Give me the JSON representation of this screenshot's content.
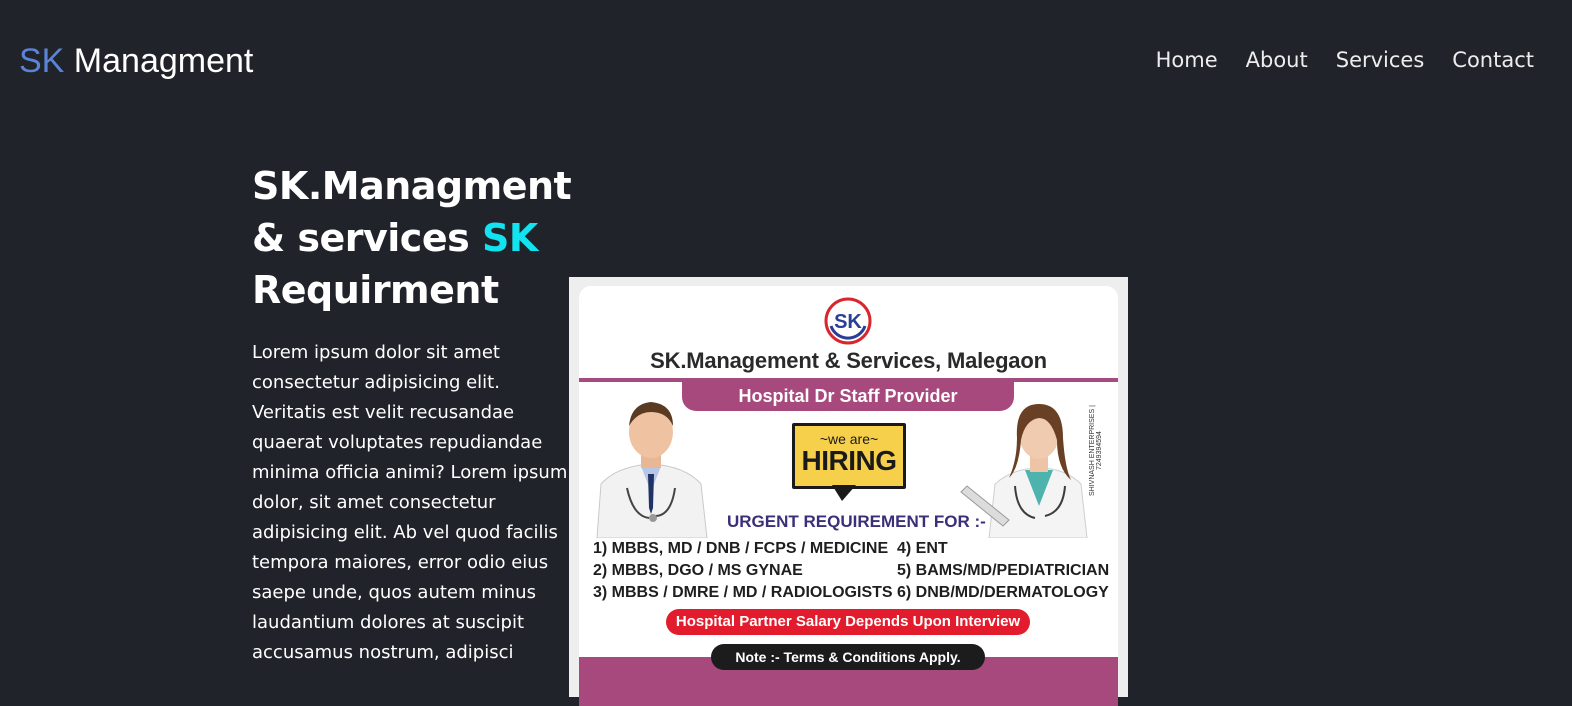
{
  "brand": {
    "logo_prefix": "SK",
    "logo_suffix": " Managment",
    "accent_color": "#5b84d6"
  },
  "nav": {
    "items": [
      {
        "label": "Home"
      },
      {
        "label": "About"
      },
      {
        "label": "Services"
      },
      {
        "label": "Contact"
      }
    ]
  },
  "hero": {
    "title_line1": "SK.Managment",
    "title_line2_white": "& services ",
    "title_line2_cyan": "SK",
    "title_line3": "Requirment",
    "highlight_color": "#12e3ef",
    "body": "Lorem ipsum dolor sit amet consectetur adipisicing elit. Veritatis est velit recusandae quaerat voluptates repudiandae minima officia animi? Lorem ipsum dolor, sit amet consectetur adipisicing elit. Ab vel quod facilis tempora maiores, error odio eius saepe unde, quos autem minus laudantium dolores at suscipit accusamus nostrum, adipisci"
  },
  "poster": {
    "logo_text": "SK",
    "company": "SK.Management & Services, Malegaon",
    "banner": "Hospital Dr Staff Provider",
    "hiring_small": "~we are~",
    "hiring_big": "HIRING",
    "side_credit": "SHIVNASH ENTERPRISES | 7249394594",
    "urgent": "URGENT REQUIREMENT FOR :-",
    "requirements": [
      {
        "left": "1) MBBS, MD / DNB  / FCPS / MEDICINE",
        "right": "4) ENT"
      },
      {
        "left": "2) MBBS, DGO / MS GYNAE",
        "right": "5) BAMS/MD/PEDIATRICIAN"
      },
      {
        "left": "3) MBBS / DMRE / MD / RADIOLOGISTS",
        "right": "6) DNB/MD/DERMATOLOGY"
      }
    ],
    "salary": "Hospital Partner Salary Depends Upon Interview",
    "note": "Note :- Terms & Conditions Apply.",
    "banner_color": "#a8497e",
    "salary_color": "#e21c2c"
  }
}
